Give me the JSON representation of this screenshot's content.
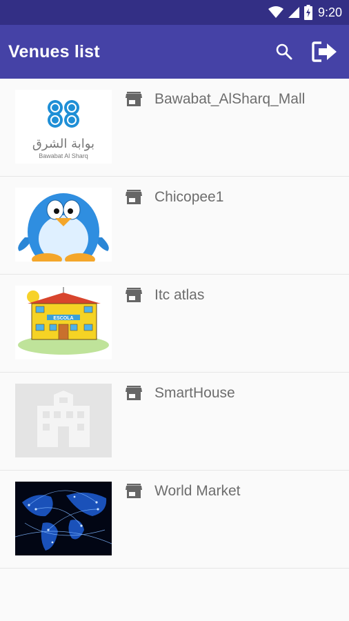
{
  "status_bar": {
    "time": "9:20",
    "icons": [
      "wifi-icon",
      "cell-signal-icon",
      "battery-charging-icon"
    ]
  },
  "app_bar": {
    "title": "Venues list",
    "actions": [
      "search-icon",
      "logout-icon"
    ]
  },
  "colors": {
    "status_bar": "#332f85",
    "app_bar": "#4542a6",
    "list_text": "#6d6d6d",
    "background": "#fafafa"
  },
  "venues": [
    {
      "name": "Bawabat_AlSharq_Mall",
      "thumbnail": "bawabat-alsharq-logo",
      "logo_text_arabic": "بوابة الشرق",
      "logo_text_latin": "Bawabat Al Sharq"
    },
    {
      "name": "Chicopee1",
      "thumbnail": "penguin-cartoon"
    },
    {
      "name": "Itc atlas",
      "thumbnail": "school-building-cartoon",
      "sign_text": "ESCOLA"
    },
    {
      "name": "SmartHouse",
      "thumbnail": "building-placeholder"
    },
    {
      "name": "World Market",
      "thumbnail": "world-network-map"
    }
  ]
}
